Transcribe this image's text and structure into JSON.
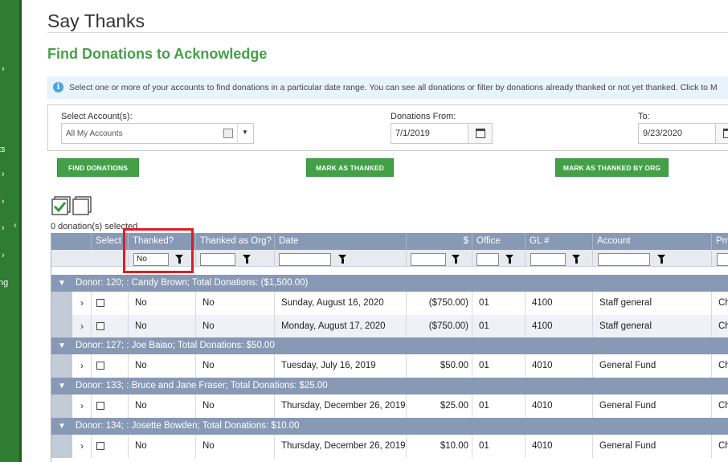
{
  "sidenav": {
    "fragments": [
      "ts",
      "ng"
    ],
    "collapse_glyph": "‹",
    "arrow_glyph": "›"
  },
  "page": {
    "title": "Say Thanks",
    "section_title": "Find Donations to Acknowledge",
    "info_text": "Select one or more of your accounts to find donations in a particular date range. You can see all donations or filter by donations already thanked or not yet thanked. Click to M"
  },
  "filters": {
    "account_label": "Select Account(s):",
    "account_value": "All My Accounts",
    "from_label": "Donations From:",
    "from_value": "7/1/2019",
    "to_label": "To:",
    "to_value": "9/23/2020"
  },
  "buttons": {
    "find": "FIND DONATIONS",
    "mark_thanked": "MARK AS THANKED",
    "mark_thanked_org": "MARK AS THANKED BY ORG"
  },
  "selection": {
    "count_text": "0 donation(s) selected"
  },
  "grid": {
    "columns": [
      "Select",
      "Thanked?",
      "Thanked as Org?",
      "Date",
      "$",
      "Office",
      "GL #",
      "Account",
      "Pm"
    ],
    "filter_values": {
      "thanked": "No"
    },
    "groups": [
      {
        "header": "Donor: 120; : Candy Brown; Total Donations: ($1,500.00)",
        "rows": [
          {
            "thanked": "No",
            "thanked_org": "No",
            "date": "Sunday, August 16, 2020",
            "amount": "($750.00)",
            "office": "01",
            "gl": "4100",
            "account": "Staff general",
            "pm": "Che"
          },
          {
            "thanked": "No",
            "thanked_org": "No",
            "date": "Monday, August 17, 2020",
            "amount": "($750.00)",
            "office": "01",
            "gl": "4100",
            "account": "Staff general",
            "pm": "Che"
          }
        ]
      },
      {
        "header": "Donor: 127; : Joe Baiao; Total Donations: $50.00",
        "rows": [
          {
            "thanked": "No",
            "thanked_org": "No",
            "date": "Tuesday, July 16, 2019",
            "amount": "$50.00",
            "office": "01",
            "gl": "4010",
            "account": "General Fund",
            "pm": "Che"
          }
        ]
      },
      {
        "header": "Donor: 133; : Bruce and Jane Fraser; Total Donations: $25.00",
        "rows": [
          {
            "thanked": "No",
            "thanked_org": "No",
            "date": "Thursday, December 26, 2019",
            "amount": "$25.00",
            "office": "01",
            "gl": "4010",
            "account": "General Fund",
            "pm": "Che"
          }
        ]
      },
      {
        "header": "Donor: 134; : Josette Bowden; Total Donations: $10.00",
        "rows": [
          {
            "thanked": "No",
            "thanked_org": "No",
            "date": "Thursday, December 26, 2019",
            "amount": "$10.00",
            "office": "01",
            "gl": "4010",
            "account": "General Fund",
            "pm": "Che"
          }
        ]
      }
    ]
  },
  "colors": {
    "brand_green": "#43a047",
    "nav_green": "#2e7d32",
    "grid_header": "#8799b4",
    "highlight_red": "#e01b24"
  }
}
